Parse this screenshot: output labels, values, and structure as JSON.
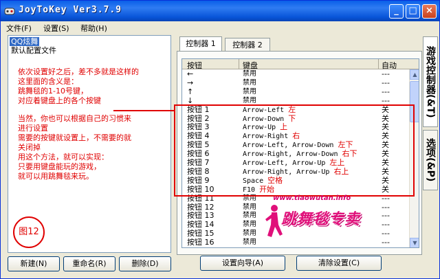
{
  "window": {
    "title": "JoyToKey Ver3.7.9",
    "min_glyph": "_",
    "max_glyph": "□",
    "close_glyph": "×"
  },
  "menu": [
    {
      "label": "文件(F)"
    },
    {
      "label": "设置(S)"
    },
    {
      "label": "帮助(H)"
    }
  ],
  "config_list": [
    {
      "label": "QQ炫舞",
      "selected": true
    },
    {
      "label": "默认配置文件",
      "selected": false
    }
  ],
  "notes": {
    "block1": [
      "依次设置好之后，差不多就是这样的",
      "这里面的含义是：",
      "跳舞毯的1-10号键，",
      "对应着键盘上的各个按键"
    ],
    "block2": [
      "当然，你也可以根据自己的习惯来",
      "进行设置",
      "需要的按键就设置上，不需要的就",
      "关闭掉",
      "用这个方法，就可以实现：",
      "只要用键盘能玩的游戏，",
      "就可以用跳舞毯来玩。"
    ],
    "figure": "图12"
  },
  "left_buttons": {
    "new": "新建(N)",
    "rename": "重命名(R)",
    "delete": "删除(D)"
  },
  "tabs": [
    {
      "label": "控制器 1",
      "active": true
    },
    {
      "label": "控制器 2",
      "active": false
    }
  ],
  "grid": {
    "headers": {
      "button": "按钮",
      "key": "键盘",
      "auto": "自动"
    },
    "rows": [
      {
        "button": "←",
        "key": "禁用",
        "auto": "---",
        "note": ""
      },
      {
        "button": "→",
        "key": "禁用",
        "auto": "---",
        "note": ""
      },
      {
        "button": "↑",
        "key": "禁用",
        "auto": "---",
        "note": ""
      },
      {
        "button": "↓",
        "key": "禁用",
        "auto": "---",
        "note": ""
      },
      {
        "button": "按钮 1",
        "key": "Arrow-Left",
        "auto": "关",
        "note": "左"
      },
      {
        "button": "按钮 2",
        "key": "Arrow-Down",
        "auto": "关",
        "note": "下"
      },
      {
        "button": "按钮 3",
        "key": "Arrow-Up",
        "auto": "关",
        "note": "上"
      },
      {
        "button": "按钮 4",
        "key": "Arrow-Right",
        "auto": "关",
        "note": "右"
      },
      {
        "button": "按钮 5",
        "key": "Arrow-Left, Arrow-Down",
        "auto": "关",
        "note": "左下"
      },
      {
        "button": "按钮 6",
        "key": "Arrow-Right, Arrow-Down",
        "auto": "关",
        "note": "右下"
      },
      {
        "button": "按钮 7",
        "key": "Arrow-Left, Arrow-Up",
        "auto": "关",
        "note": "左上"
      },
      {
        "button": "按钮 8",
        "key": "Arrow-Right, Arrow-Up",
        "auto": "关",
        "note": "右上"
      },
      {
        "button": "按钮 9",
        "key": "Space",
        "auto": "关",
        "note": "空格"
      },
      {
        "button": "按钮 10",
        "key": "F10",
        "auto": "关",
        "note": "开始"
      },
      {
        "button": "按钮 11",
        "key": "禁用",
        "auto": "---",
        "note": ""
      },
      {
        "button": "按钮 12",
        "key": "禁用",
        "auto": "---",
        "note": ""
      },
      {
        "button": "按钮 13",
        "key": "禁用",
        "auto": "---",
        "note": ""
      },
      {
        "button": "按钮 14",
        "key": "禁用",
        "auto": "---",
        "note": ""
      },
      {
        "button": "按钮 15",
        "key": "禁用",
        "auto": "---",
        "note": ""
      },
      {
        "button": "按钮 16",
        "key": "禁用",
        "auto": "---",
        "note": ""
      }
    ]
  },
  "bottom_buttons": {
    "wizard": "设置向导(A)",
    "clear": "清除设置(C)"
  },
  "side_tabs": [
    {
      "label": "游戏控制器(&T)",
      "active": true
    },
    {
      "label": "选项(&P)",
      "active": false
    }
  ],
  "watermark": {
    "url": "www.tiaowutan.info",
    "logo": "跳舞毯专卖"
  },
  "colors": {
    "annotation": "#e00000",
    "titlebar": "#0a5fe8",
    "selection": "#316ac5",
    "watermark": "#e0107a"
  }
}
